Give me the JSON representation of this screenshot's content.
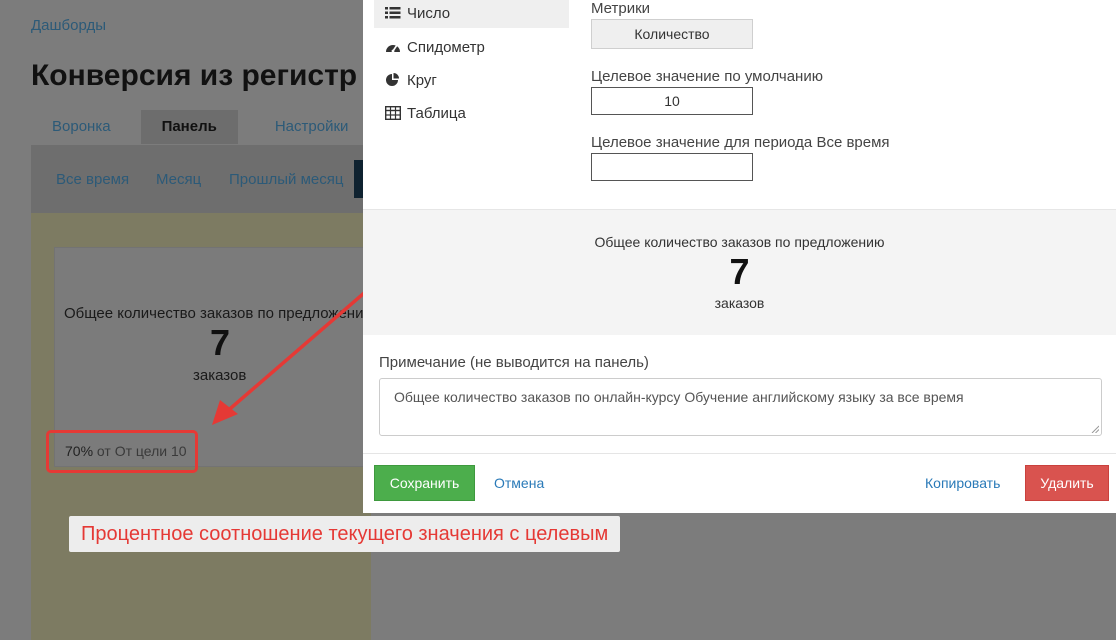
{
  "background": {
    "breadcrumb": "Дашборды",
    "page_title": "Конверсия из регистр",
    "tabs": [
      {
        "label": "Воронка",
        "active": false
      },
      {
        "label": "Панель",
        "active": true
      },
      {
        "label": "Настройки",
        "active": false
      }
    ],
    "periods": [
      "Все время",
      "Месяц",
      "Прошлый месяц"
    ],
    "widget": {
      "title": "Общее количество заказов по предложени",
      "value": "7",
      "unit": "заказов",
      "progress_pct": "70%",
      "progress_rest": " от От цели 10"
    }
  },
  "annotation": {
    "caption": "Процентное соотношение текущего значения с целевым",
    "color": "#e53935"
  },
  "modal": {
    "side_nav": [
      {
        "label": "Число",
        "icon": "list-icon",
        "active": true
      },
      {
        "label": "Спидометр",
        "icon": "speedometer-icon",
        "active": false
      },
      {
        "label": "Круг",
        "icon": "pie-chart-icon",
        "active": false
      },
      {
        "label": "Таблица",
        "icon": "table-icon",
        "active": false
      }
    ],
    "metrics_label": "Метрики",
    "metric_value": "Количество",
    "default_target_label": "Целевое значение по умолчанию",
    "default_target_value": "10",
    "period_target_label": "Целевое значение для периода Все время",
    "period_target_value": "",
    "preview": {
      "title": "Общее количество заказов по предложению",
      "value": "7",
      "unit": "заказов"
    },
    "note_label": "Примечание (не выводится на панель)",
    "note_value": "Общее количество заказов по онлайн-курсу Обучение английскому языку за все время",
    "buttons": {
      "save": "Сохранить",
      "cancel": "Отмена",
      "copy": "Копировать",
      "delete": "Удалить"
    },
    "colors": {
      "save": "#4cae4c",
      "delete": "#d9534f",
      "link": "#2a7ab8"
    }
  }
}
